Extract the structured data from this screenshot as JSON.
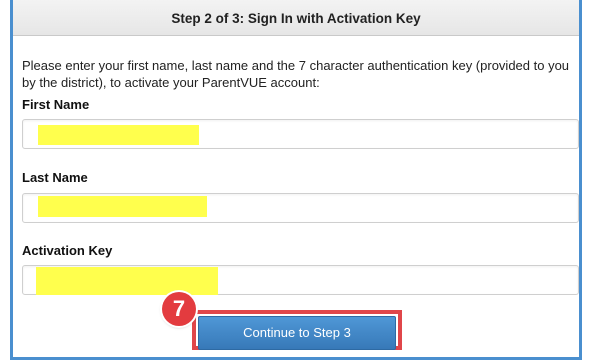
{
  "panel": {
    "title": "Step 2 of 3: Sign In with Activation Key",
    "intro": "Please enter your first name, last name and the 7 character authentication key (provided to you by the district), to activate your ParentVUE account:"
  },
  "fields": {
    "first_name": {
      "label": "First Name",
      "value": ""
    },
    "last_name": {
      "label": "Last Name",
      "value": ""
    },
    "activation_key": {
      "label": "Activation Key",
      "value": ""
    }
  },
  "button": {
    "label": "Continue to Step 3"
  },
  "annotation": {
    "step_number": "7"
  },
  "colors": {
    "panel_border": "#4a8fcf",
    "button": "#3f87c8",
    "highlight_box": "#e0464a",
    "badge": "#e33b3f",
    "redaction": "#ffff4d"
  }
}
